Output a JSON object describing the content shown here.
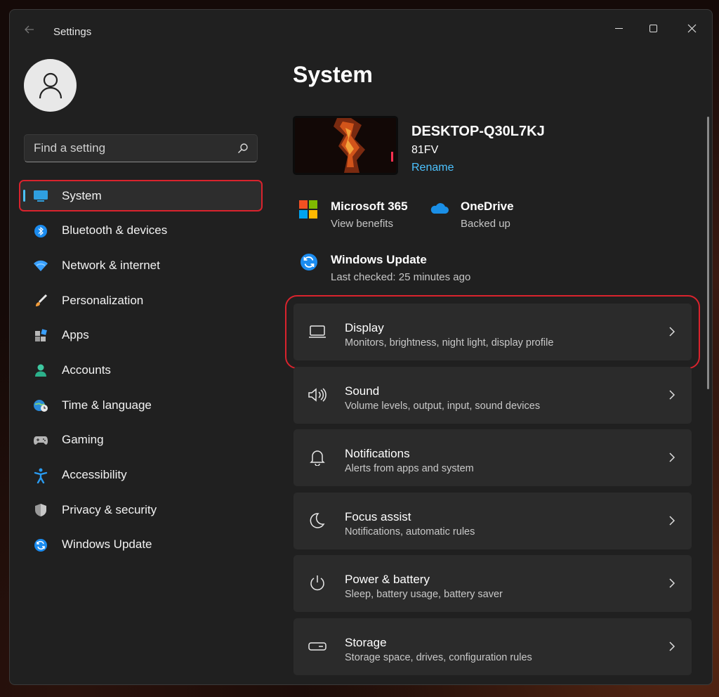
{
  "window": {
    "app_title": "Settings"
  },
  "sidebar": {
    "search": {
      "placeholder": "Find a setting",
      "value": ""
    },
    "items": [
      {
        "label": "System",
        "icon": "monitor-icon",
        "active": true
      },
      {
        "label": "Bluetooth & devices",
        "icon": "bluetooth-icon"
      },
      {
        "label": "Network & internet",
        "icon": "wifi-icon"
      },
      {
        "label": "Personalization",
        "icon": "brush-icon"
      },
      {
        "label": "Apps",
        "icon": "apps-icon"
      },
      {
        "label": "Accounts",
        "icon": "person-icon"
      },
      {
        "label": "Time & language",
        "icon": "globe-clock-icon"
      },
      {
        "label": "Gaming",
        "icon": "gamepad-icon"
      },
      {
        "label": "Accessibility",
        "icon": "accessibility-icon"
      },
      {
        "label": "Privacy & security",
        "icon": "shield-icon"
      },
      {
        "label": "Windows Update",
        "icon": "update-icon"
      }
    ]
  },
  "main": {
    "title": "System",
    "device": {
      "name": "DESKTOP-Q30L7KJ",
      "model": "81FV",
      "rename_label": "Rename"
    },
    "tiles": [
      {
        "title": "Microsoft 365",
        "subtitle": "View benefits",
        "icon": "microsoft-logo-icon"
      },
      {
        "title": "OneDrive",
        "subtitle": "Backed up",
        "icon": "cloud-icon"
      },
      {
        "title": "Windows Update",
        "subtitle": "Last checked: 25 minutes ago",
        "icon": "update-icon"
      }
    ],
    "cards": [
      {
        "title": "Display",
        "subtitle": "Monitors, brightness, night light, display profile",
        "icon": "laptop-icon"
      },
      {
        "title": "Sound",
        "subtitle": "Volume levels, output, input, sound devices",
        "icon": "speaker-icon"
      },
      {
        "title": "Notifications",
        "subtitle": "Alerts from apps and system",
        "icon": "bell-icon"
      },
      {
        "title": "Focus assist",
        "subtitle": "Notifications, automatic rules",
        "icon": "moon-icon"
      },
      {
        "title": "Power & battery",
        "subtitle": "Sleep, battery usage, battery saver",
        "icon": "power-icon"
      },
      {
        "title": "Storage",
        "subtitle": "Storage space, drives, configuration rules",
        "icon": "drive-icon"
      }
    ]
  },
  "colors": {
    "accent": "#4cc2ff",
    "highlight": "#d9232d",
    "window_bg": "#202020",
    "card_bg": "#2b2b2b"
  }
}
